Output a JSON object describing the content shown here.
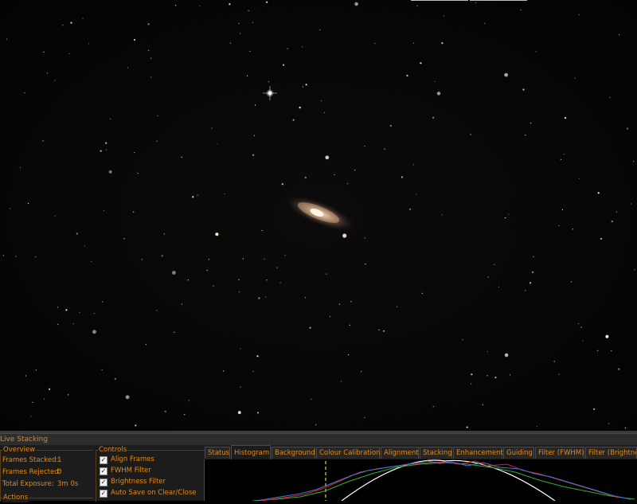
{
  "panel": {
    "title": "Live Stacking"
  },
  "overview": {
    "title": "Overview",
    "rows": [
      {
        "label": "Frames Stacked:",
        "value": "1"
      },
      {
        "label": "Frames Rejected:",
        "value": "0"
      },
      {
        "label": "Total Exposure:",
        "value": "3m 0s"
      }
    ]
  },
  "actions": {
    "title": "Actions"
  },
  "controls": {
    "title": "Controls",
    "items": [
      {
        "label": "Align Frames",
        "checked": true
      },
      {
        "label": "FWHM Filter",
        "checked": true
      },
      {
        "label": "Brightness Filter",
        "checked": true
      },
      {
        "label": "Auto Save on Clear/Close",
        "checked": true
      }
    ]
  },
  "tabs": [
    {
      "label": "Status"
    },
    {
      "label": "Histogram",
      "active": true
    },
    {
      "label": "Background"
    },
    {
      "label": "Colour Calibration"
    },
    {
      "label": "Alignment"
    },
    {
      "label": "Stacking"
    },
    {
      "label": "Enhancement"
    },
    {
      "label": "Guiding"
    },
    {
      "label": "Filter (FWHM)"
    },
    {
      "label": "Filter (Brightnes"
    }
  ],
  "colors": {
    "accent": "#e08a1e",
    "panel_bg": "#1c1c1c",
    "hist_red": "#e02020",
    "hist_green": "#30b030",
    "hist_blue": "#3a7ae0",
    "hist_curve": "#ffffff",
    "hist_marker": "#f0e000"
  }
}
